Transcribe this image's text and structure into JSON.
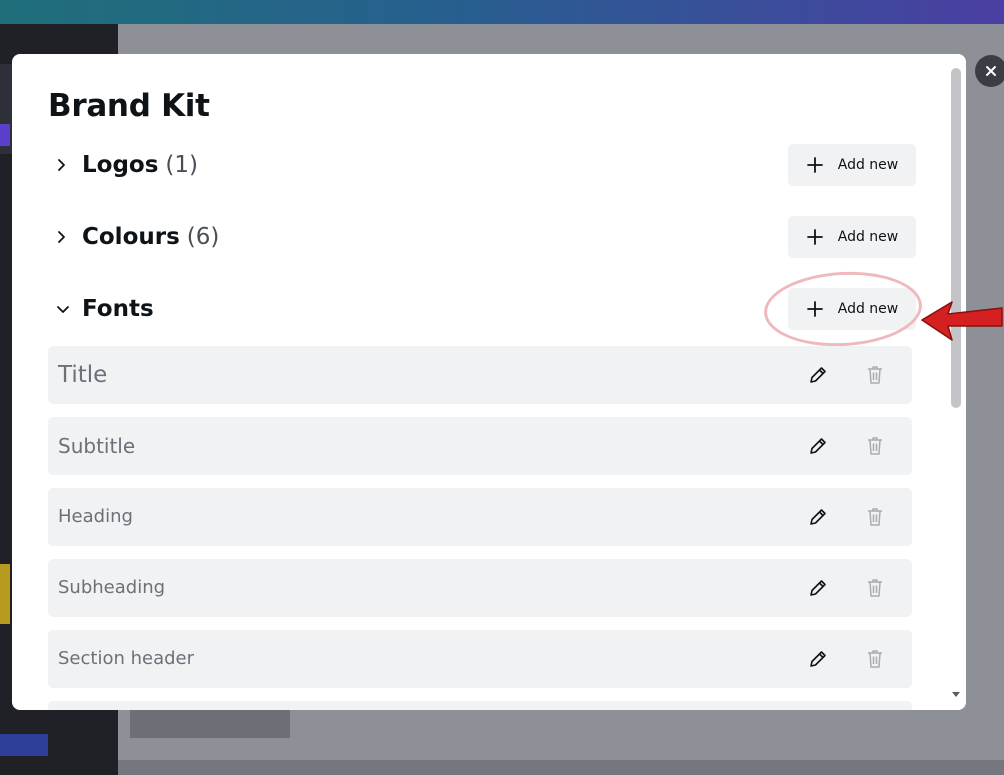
{
  "modal": {
    "title": "Brand Kit",
    "sections": [
      {
        "id": "logos",
        "name": "Logos",
        "count": "(1)",
        "expanded": false,
        "add_label": "Add new"
      },
      {
        "id": "colours",
        "name": "Colours",
        "count": "(6)",
        "expanded": false,
        "add_label": "Add new"
      },
      {
        "id": "fonts",
        "name": "Fonts",
        "count": "",
        "expanded": true,
        "add_label": "Add new"
      }
    ],
    "fonts": [
      "Title",
      "Subtitle",
      "Heading",
      "Subheading",
      "Section header"
    ]
  },
  "icons": {
    "close": "close-icon",
    "collapsed": "chevron-right-icon",
    "expanded": "chevron-down-icon",
    "add": "plus-icon",
    "edit": "pencil-icon",
    "delete": "trash-icon"
  },
  "colors": {
    "row_background": "#f1f2f4",
    "highlight_ring": "#efb9bc",
    "annotation_arrow": "#d42020"
  }
}
